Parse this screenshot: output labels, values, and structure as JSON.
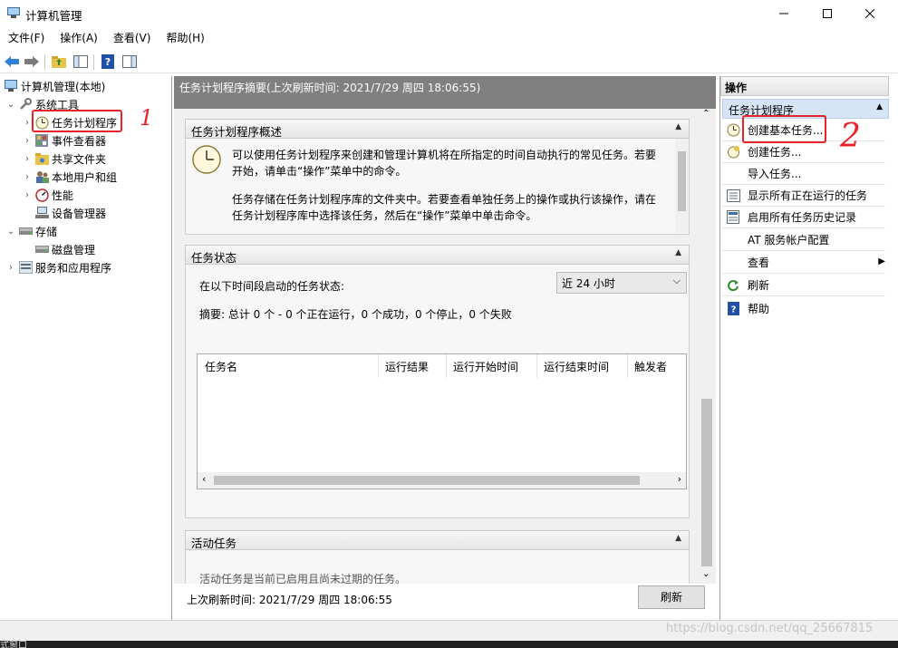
{
  "window": {
    "title": "计算机管理"
  },
  "menu": [
    "文件(F)",
    "操作(A)",
    "查看(V)",
    "帮助(H)"
  ],
  "tree": {
    "root": "计算机管理(本地)",
    "system_tools": "系统工具",
    "task_scheduler": "任务计划程序",
    "event_viewer": "事件查看器",
    "shared_folders": "共享文件夹",
    "local_users": "本地用户和组",
    "performance": "性能",
    "device_manager": "设备管理器",
    "storage": "存储",
    "disk_management": "磁盘管理",
    "services_apps": "服务和应用程序"
  },
  "center": {
    "header": "任务计划程序摘要(上次刷新时间: 2021/7/29 周四 18:06:55)",
    "overview_title": "任务计划程序概述",
    "overview_p1": "可以使用任务计划程序来创建和管理计算机将在所指定的时间自动执行的常见任务。若要开始，请单击“操作”菜单中的命令。",
    "overview_p2": "任务存储在任务计划程序库的文件夹中。若要查看单独任务上的操作或执行该操作，请在任务计划程序库中选择该任务，然后在“操作”菜单中单击命令。",
    "status_title": "任务状态",
    "status_label": "在以下时间段启动的任务状态:",
    "status_period": "近 24 小时",
    "summary": "摘要: 总计 0 个 - 0 个正在运行，0 个成功，0 个停止，0 个失败",
    "columns": [
      "任务名",
      "运行结果",
      "运行开始时间",
      "运行结束时间",
      "触发者"
    ],
    "active_title": "活动任务",
    "active_text_cut": "活动任务是当前已启用且尚未过期的任务。",
    "footer_time": "上次刷新时间: 2021/7/29 周四 18:06:55",
    "refresh_button": "刷新"
  },
  "actions": {
    "header": "操作",
    "section": "任务计划程序",
    "items": [
      "创建基本任务...",
      "创建任务...",
      "导入任务...",
      "显示所有正在运行的任务",
      "启用所有任务历史记录",
      "AT 服务帐户配置",
      "查看",
      "刷新",
      "帮助"
    ]
  },
  "annotations": {
    "mark1": "1",
    "mark2": "2"
  },
  "status_bar_cut": "式窗口",
  "watermark": "https://blog.csdn.net/qq_25667815",
  "colors": {
    "annotation": "#e8212a",
    "section_selected": "#d6e5f5",
    "header_gray": "#808080"
  }
}
